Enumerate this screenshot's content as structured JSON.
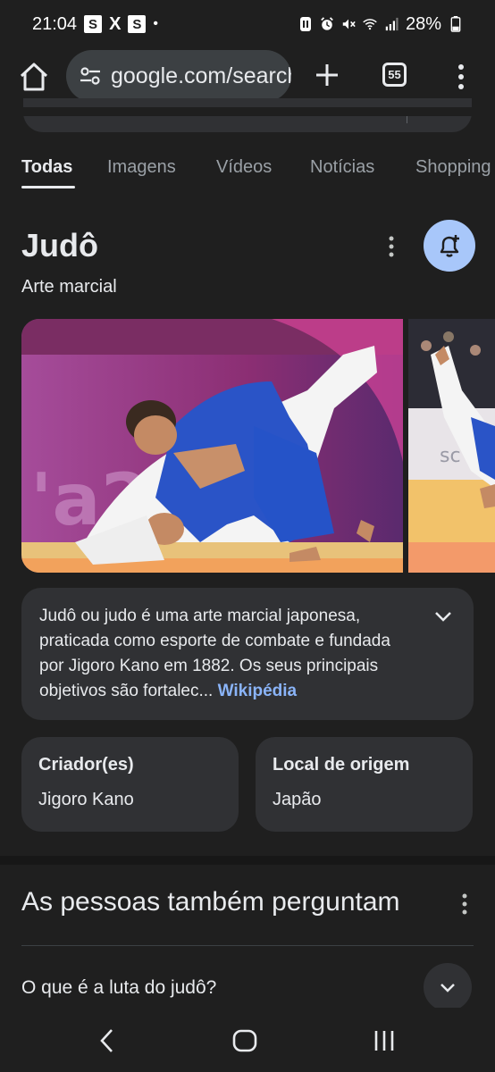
{
  "status_bar": {
    "time": "21:04",
    "app_icons": [
      "S",
      "X",
      "S"
    ],
    "notification_dot": "•",
    "battery": "28%",
    "icons": [
      "nfc-icon",
      "alarm-icon",
      "mute-icon",
      "wifi-icon",
      "signal-icon",
      "battery-icon"
    ]
  },
  "browser": {
    "url": "google.com/search",
    "tab_count": "55",
    "icons": [
      "home-icon",
      "site-settings-icon",
      "new-tab-icon",
      "tab-switcher-icon",
      "more-vert-icon"
    ]
  },
  "filter_tabs": {
    "items": [
      "Todas",
      "Imagens",
      "Vídeos",
      "Notícias",
      "Shopping"
    ],
    "active": "Todas"
  },
  "knowledge_panel": {
    "title": "Judô",
    "subtitle": "Arte marcial",
    "description": "Judô ou judo é uma arte marcial japonesa, praticada como esporte de combate e fundada por Jigoro Kano em 1882. Os seus principais objetivos são fortalec...",
    "source_link": "Wikipédia",
    "facts": [
      {
        "label": "Criador(es)",
        "value": "Jigoro Kano"
      },
      {
        "label": "Local de origem",
        "value": "Japão"
      }
    ],
    "colors": {
      "bell_button": "#a8c7fa",
      "link": "#8ab4f8",
      "card": "#303134"
    }
  },
  "people_also_ask": {
    "title": "As pessoas também perguntam",
    "questions": [
      "O que é a luta do judô?"
    ]
  },
  "nav_bar": {
    "icons": [
      "back-icon",
      "home-circle-icon",
      "recents-icon"
    ]
  }
}
